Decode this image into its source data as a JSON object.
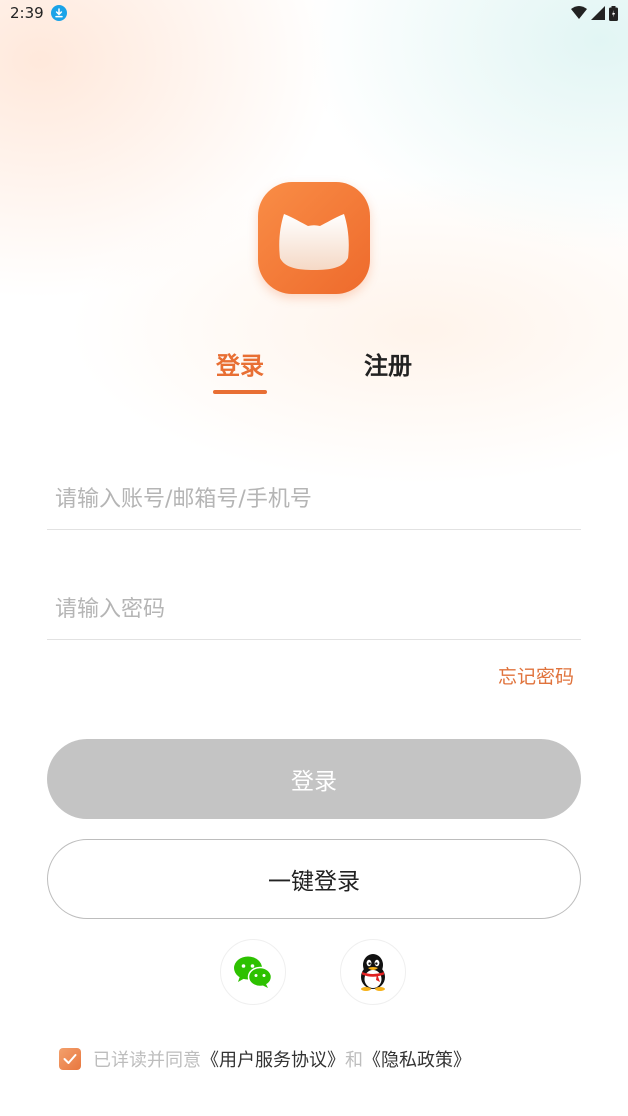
{
  "status_bar": {
    "time": "2:39"
  },
  "tabs": {
    "login": "登录",
    "register": "注册",
    "active": "login"
  },
  "form": {
    "account_placeholder": "请输入账号/邮箱号/手机号",
    "password_placeholder": "请输入密码",
    "forgot_password": "忘记密码"
  },
  "buttons": {
    "login": "登录",
    "one_key_login": "一键登录"
  },
  "social": [
    "wechat-icon",
    "qq-icon"
  ],
  "agreement": {
    "checked": true,
    "prefix": "已详读并同意",
    "user_agreement": "《用户服务协议》",
    "and": "和",
    "privacy_policy": "《隐私政策》"
  },
  "colors": {
    "accent": "#e86f34",
    "login_button_disabled": "#c4c4c4",
    "wechat": "#2dc100",
    "download_badge": "#1aa3e8"
  }
}
